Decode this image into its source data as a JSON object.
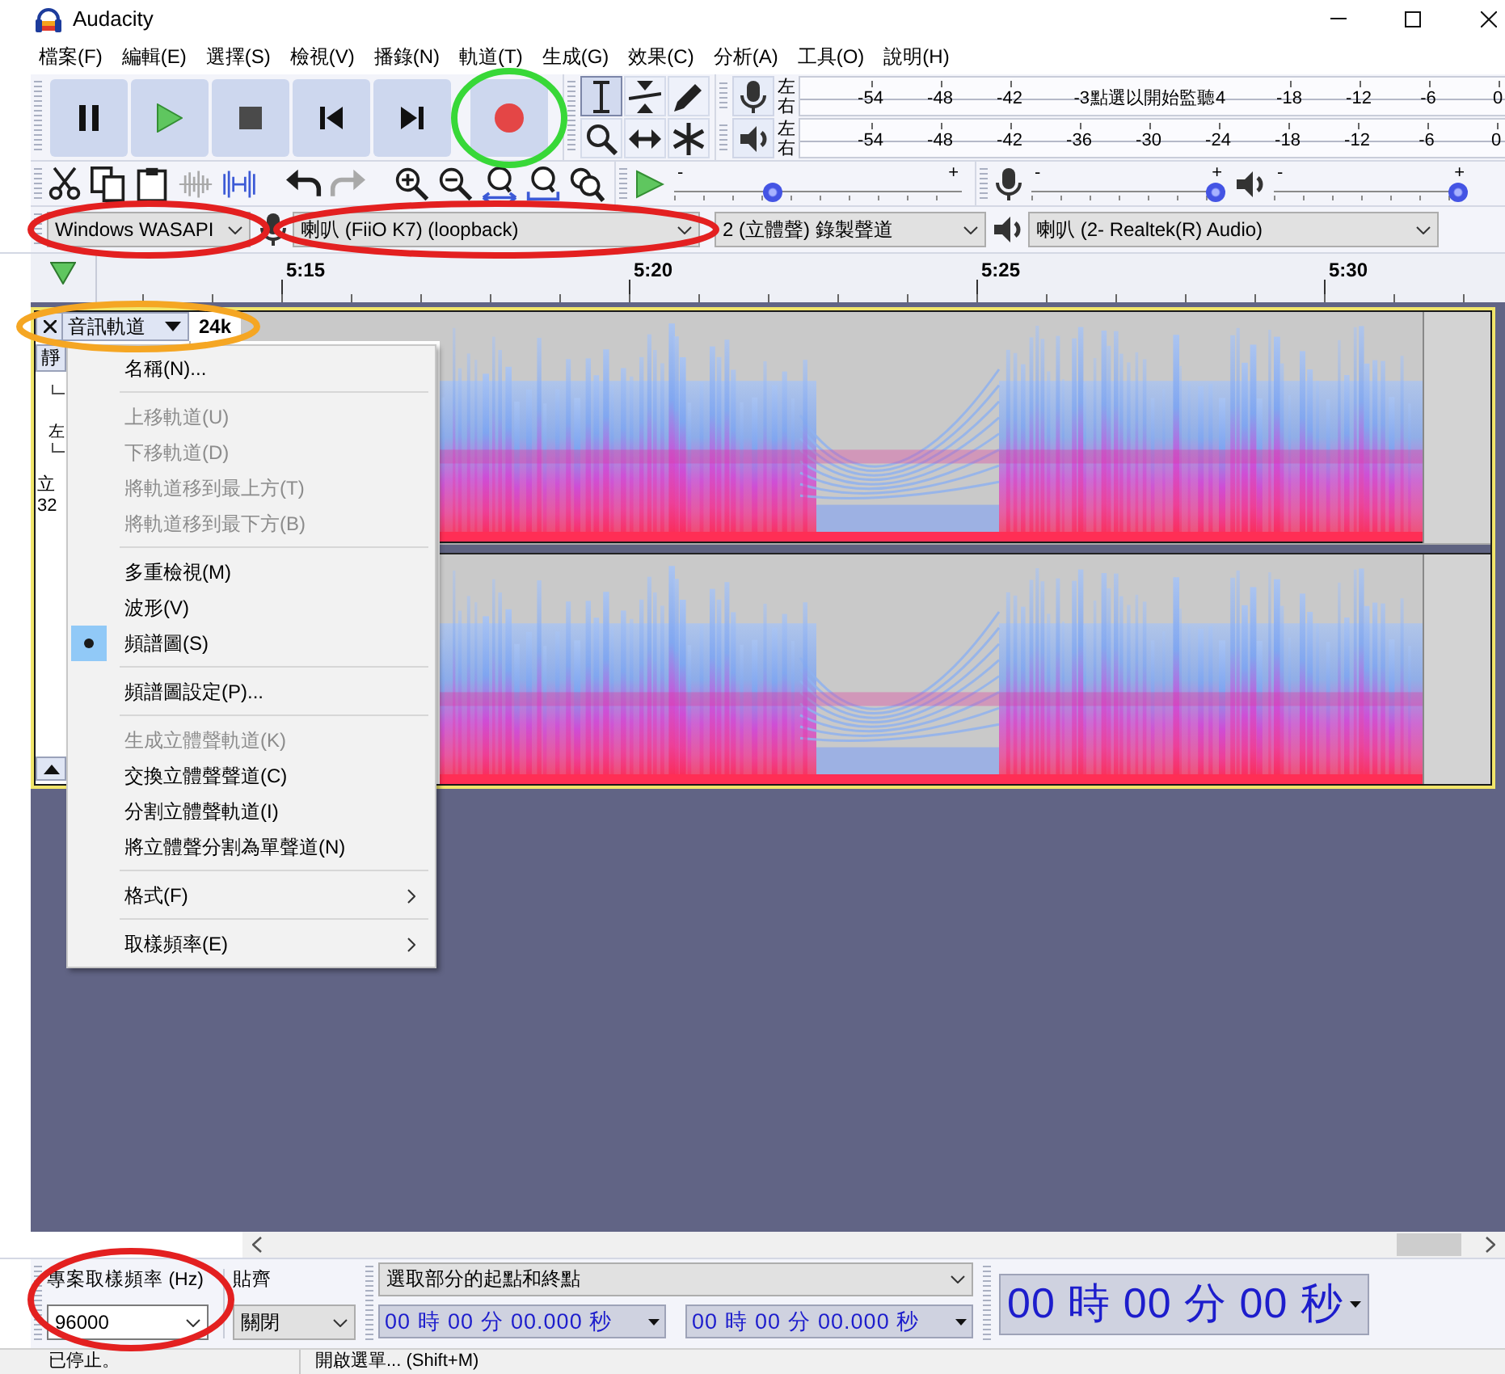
{
  "window": {
    "title": "Audacity"
  },
  "menu_bar": [
    "檔案(F)",
    "編輯(E)",
    "選擇(S)",
    "檢視(V)",
    "播錄(N)",
    "軌道(T)",
    "生成(G)",
    "效果(C)",
    "分析(A)",
    "工具(O)",
    "說明(H)"
  ],
  "transport": {
    "record_button": {
      "annotation": {
        "kind": "circle",
        "color": "#38d838"
      }
    }
  },
  "tools": [
    {
      "kind": "select",
      "selected": true
    },
    {
      "kind": "envelope",
      "selected": false
    },
    {
      "kind": "draw",
      "selected": false
    },
    {
      "kind": "zoom",
      "selected": false
    },
    {
      "kind": "timeshift",
      "selected": false
    },
    {
      "kind": "multi",
      "selected": false
    }
  ],
  "meters": [
    {
      "kind": "recording",
      "channels": [
        "左",
        "右"
      ],
      "scale": [
        {
          "kind": "tick",
          "label": "-54"
        },
        {
          "kind": "tick",
          "label": "-48"
        },
        {
          "kind": "tick",
          "label": "-42"
        },
        {
          "kind": "tick",
          "label": "-3"
        },
        {
          "kind": "prompt",
          "label": "點選以開始監聽"
        },
        {
          "kind": "tick",
          "label": "4"
        },
        {
          "kind": "tick",
          "label": "-18"
        },
        {
          "kind": "tick",
          "label": "-12"
        },
        {
          "kind": "tick",
          "label": "-6"
        },
        {
          "kind": "tick",
          "label": "0"
        }
      ]
    },
    {
      "kind": "playback",
      "channels": [
        "左",
        "右"
      ],
      "scale": [
        {
          "kind": "tick",
          "label": "-54"
        },
        {
          "kind": "tick",
          "label": "-48"
        },
        {
          "kind": "tick",
          "label": "-42"
        },
        {
          "kind": "tick",
          "label": "-36"
        },
        {
          "kind": "tick",
          "label": "-30"
        },
        {
          "kind": "tick",
          "label": "-24"
        },
        {
          "kind": "tick",
          "label": "-18"
        },
        {
          "kind": "tick",
          "label": "-12"
        },
        {
          "kind": "tick",
          "label": "-6"
        },
        {
          "kind": "tick",
          "label": "0"
        }
      ]
    }
  ],
  "edit_toolbar": [
    [
      {
        "kind": "cut",
        "disabled": false
      },
      {
        "kind": "copy",
        "disabled": false
      },
      {
        "kind": "paste",
        "disabled": false
      },
      {
        "kind": "trim",
        "disabled": true
      },
      {
        "kind": "silence",
        "disabled": false
      }
    ],
    [
      {
        "kind": "undo",
        "disabled": false
      },
      {
        "kind": "redo",
        "disabled": true
      }
    ],
    [
      {
        "kind": "zoom_in",
        "disabled": false
      },
      {
        "kind": "zoom_out",
        "disabled": false
      },
      {
        "kind": "fit_selection",
        "disabled": false
      },
      {
        "kind": "fit_project",
        "disabled": false
      },
      {
        "kind": "zoom_toggle",
        "disabled": false
      }
    ]
  ],
  "play_at_speed": {
    "min_label": "-",
    "max_label": "+",
    "level": 0.33
  },
  "mixer": [
    {
      "kind": "recording",
      "min_label": "-",
      "max_label": "+",
      "level": 1
    },
    {
      "kind": "playback",
      "min_label": "-",
      "max_label": "+",
      "level": 1
    }
  ],
  "devices": {
    "host": {
      "value": "Windows WASAPI",
      "annotation": {
        "kind": "circle",
        "color": "#e32020"
      }
    },
    "recording": {
      "value": "喇叭 (FiiO K7) (loopback)",
      "annotation": {
        "kind": "circle",
        "color": "#e32020"
      }
    },
    "channels": {
      "value": "2 (立體聲) 錄製聲道"
    },
    "playback": {
      "value": "喇叭 (2- Realtek(R) Audio)"
    }
  },
  "timeline": {
    "labels": [
      "5:15",
      "5:20",
      "5:25",
      "5:30"
    ]
  },
  "track": {
    "name": "音訊軌道",
    "focused": true,
    "annotation": {
      "kind": "circle",
      "color": "#f5a623"
    },
    "ruler_label": "24k",
    "mute_label": "靜",
    "pan_label": "左",
    "info": [
      "立",
      "32"
    ]
  },
  "context_menu": {
    "groups": [
      [
        {
          "kind": "command",
          "label": "名稱(N)...",
          "disabled": false
        }
      ],
      [
        {
          "kind": "command",
          "label": "上移軌道(U)",
          "disabled": true
        },
        {
          "kind": "command",
          "label": "下移軌道(D)",
          "disabled": true
        },
        {
          "kind": "command",
          "label": "將軌道移到最上方(T)",
          "disabled": true
        },
        {
          "kind": "command",
          "label": "將軌道移到最下方(B)",
          "disabled": true
        }
      ],
      [
        {
          "kind": "radio",
          "label": "多重檢視(M)",
          "disabled": false,
          "selected": false
        },
        {
          "kind": "radio",
          "label": "波形(V)",
          "disabled": false,
          "selected": false
        },
        {
          "kind": "radio",
          "label": "頻譜圖(S)",
          "disabled": false,
          "selected": true
        }
      ],
      [
        {
          "kind": "command",
          "label": "頻譜圖設定(P)...",
          "disabled": false
        }
      ],
      [
        {
          "kind": "command",
          "label": "生成立體聲軌道(K)",
          "disabled": true
        },
        {
          "kind": "command",
          "label": "交換立體聲聲道(C)",
          "disabled": false
        },
        {
          "kind": "command",
          "label": "分割立體聲軌道(I)",
          "disabled": false
        },
        {
          "kind": "command",
          "label": "將立體聲分割為單聲道(N)",
          "disabled": false
        }
      ],
      [
        {
          "kind": "submenu",
          "label": "格式(F)",
          "disabled": false
        }
      ],
      [
        {
          "kind": "submenu",
          "label": "取樣頻率(E)",
          "disabled": false
        }
      ]
    ]
  },
  "selection_toolbar": {
    "rate": {
      "label": "專案取樣頻率 (Hz)",
      "value": "96000",
      "annotation": {
        "kind": "circle",
        "color": "#e32020"
      }
    },
    "snap": {
      "label": "貼齊",
      "value": "關閉"
    },
    "mode": {
      "value": "選取部分的起點和終點"
    },
    "times": [
      "00 時 00 分 00.000 秒",
      "00 時 00 分 00.000 秒"
    ]
  },
  "time_display": {
    "value": "00 時 00 分 00 秒"
  },
  "status_bar": [
    "已停止。",
    "開啟選單... (Shift+M)"
  ]
}
